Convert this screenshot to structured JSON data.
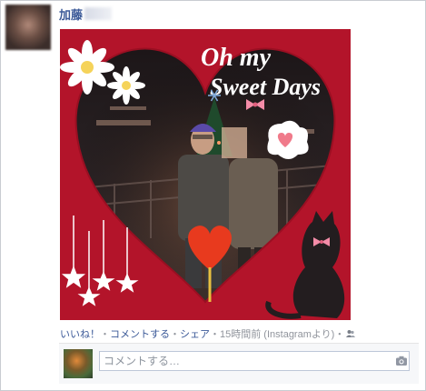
{
  "post": {
    "author_name": "加藤",
    "photo": {
      "title_line1": "Oh my",
      "title_line2": "Sweet Days",
      "colors": {
        "background": "#b3142a",
        "text": "#ffffff",
        "ribbon": "#f48ca8"
      }
    }
  },
  "actions": {
    "like": "いいね！",
    "sep1": "・",
    "comment": "コメントする",
    "sep2": "・",
    "share": "シェア",
    "sep3": "・",
    "time": "15時間前",
    "via": " (Instagramより)・"
  },
  "comment": {
    "placeholder": "コメントする…"
  },
  "icons": {
    "audience": "people-icon",
    "camera": "camera-icon"
  }
}
